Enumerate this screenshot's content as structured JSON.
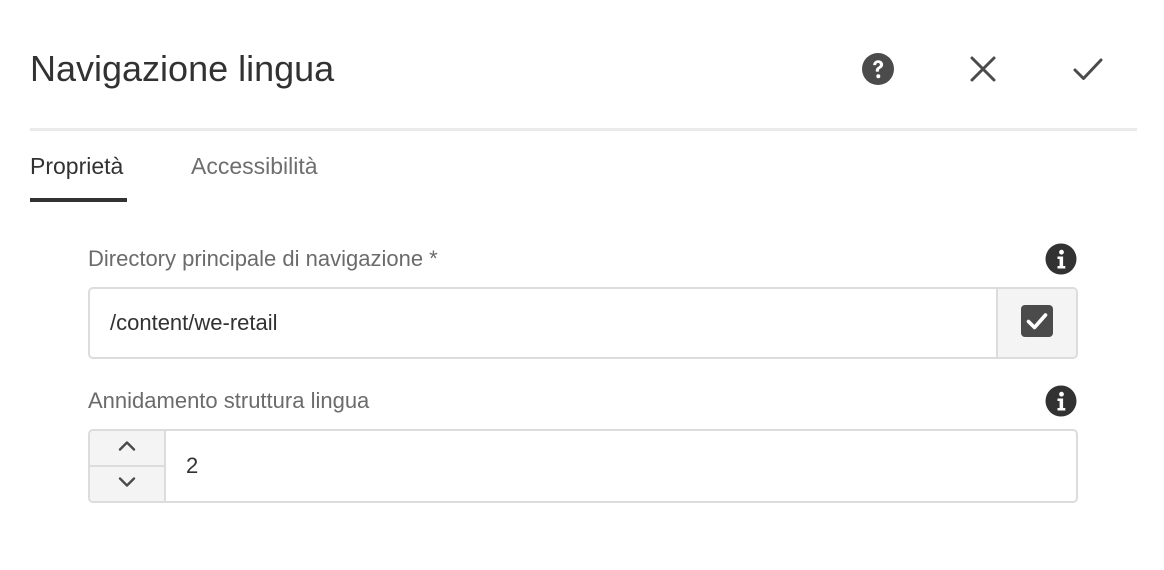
{
  "dialog": {
    "title": "Navigazione lingua",
    "help_icon": "help-icon",
    "close_icon": "close-icon",
    "done_icon": "checkmark-icon"
  },
  "tabs": [
    {
      "label": "Proprietà",
      "active": true
    },
    {
      "label": "Accessibilità",
      "active": false
    }
  ],
  "fields": {
    "navigation_root": {
      "label": "Directory principale di navigazione *",
      "value": "/content/we-retail",
      "info_icon": "info-icon",
      "picker_icon": "checkbox-checked-icon"
    },
    "structure_depth": {
      "label": "Annidamento struttura lingua",
      "value": "2",
      "info_icon": "info-icon",
      "increment_icon": "chevron-up-icon",
      "decrement_icon": "chevron-down-icon"
    }
  },
  "colors": {
    "text_primary": "#323232",
    "text_secondary": "#6e6e6e",
    "icon_dark": "#4b4b4b",
    "border": "#dcdcdc",
    "field_button_bg": "#f4f4f4"
  }
}
